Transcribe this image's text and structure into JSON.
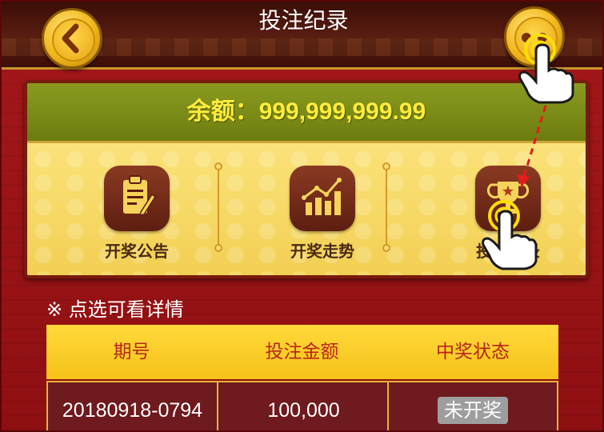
{
  "header": {
    "title": "投注纪录"
  },
  "balance": {
    "text": "余额：999,999,999.99"
  },
  "menu": [
    {
      "label": "开奖公告",
      "icon": "clipboard-icon"
    },
    {
      "label": "开奖走势",
      "icon": "trend-chart-icon"
    },
    {
      "label": "投注纪录",
      "icon": "trophy-icon"
    }
  ],
  "hint": "※ 点选可看详情",
  "table": {
    "headers": [
      "期号",
      "投注金额",
      "中奖状态"
    ],
    "rows": [
      {
        "period": "20180918-0794",
        "amount": "100,000",
        "status": "未开奖"
      }
    ]
  },
  "colors": {
    "accent": "#ffec3d",
    "header_text": "#b8261a",
    "background": "#9c1212"
  }
}
